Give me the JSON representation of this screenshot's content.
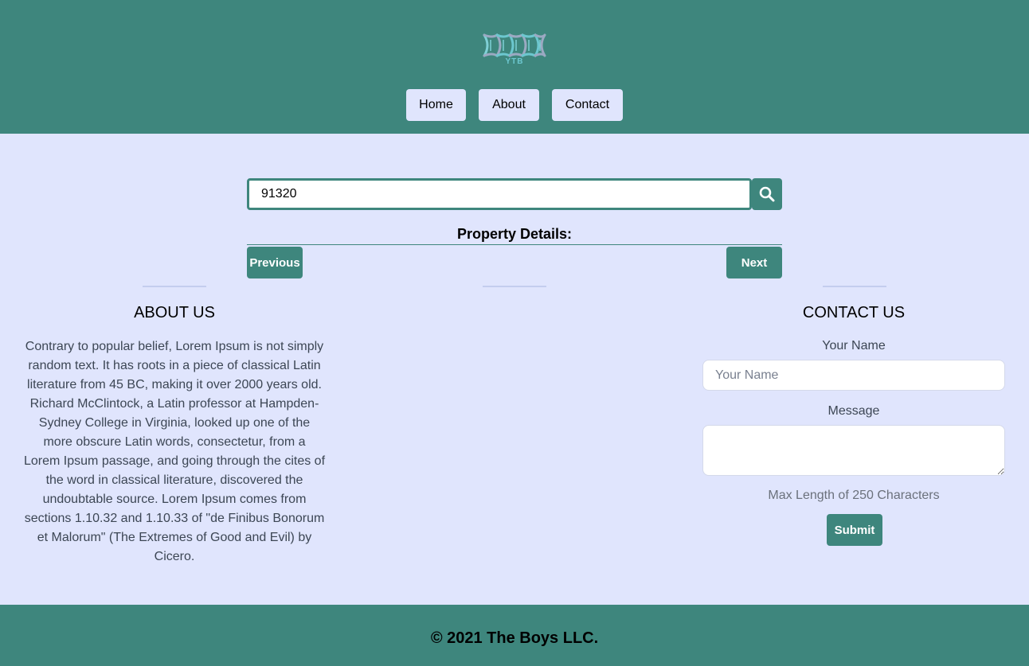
{
  "header": {
    "logo_text": "YTB",
    "nav": [
      {
        "label": "Home"
      },
      {
        "label": "About"
      },
      {
        "label": "Contact"
      }
    ]
  },
  "search": {
    "value": "91320",
    "icon": "search-icon"
  },
  "details": {
    "title": "Property Details:",
    "previous_label": "Previous",
    "next_label": "Next"
  },
  "about": {
    "heading": "ABOUT US",
    "text": "Contrary to popular belief, Lorem Ipsum is not simply random text. It has roots in a piece of classical Latin literature from 45 BC, making it over 2000 years old. Richard McClintock, a Latin professor at Hampden-Sydney College in Virginia, looked up one of the more obscure Latin words, consectetur, from a Lorem Ipsum passage, and going through the cites of the word in classical literature, discovered the undoubtable source. Lorem Ipsum comes from sections 1.10.32 and 1.10.33 of \"de Finibus Bonorum et Malorum\" (The Extremes of Good and Evil) by Cicero."
  },
  "contact": {
    "heading": "CONTACT US",
    "name_label": "Your Name",
    "name_placeholder": "Your Name",
    "name_value": "",
    "message_label": "Message",
    "message_value": "",
    "max_length_note": "Max Length of 250 Characters",
    "submit_label": "Submit"
  },
  "footer": {
    "text": "© 2021 The Boys LLC."
  },
  "colors": {
    "primary": "#3e867d",
    "background": "#e0e5fd",
    "logo_accent": "#6cc7cf"
  }
}
